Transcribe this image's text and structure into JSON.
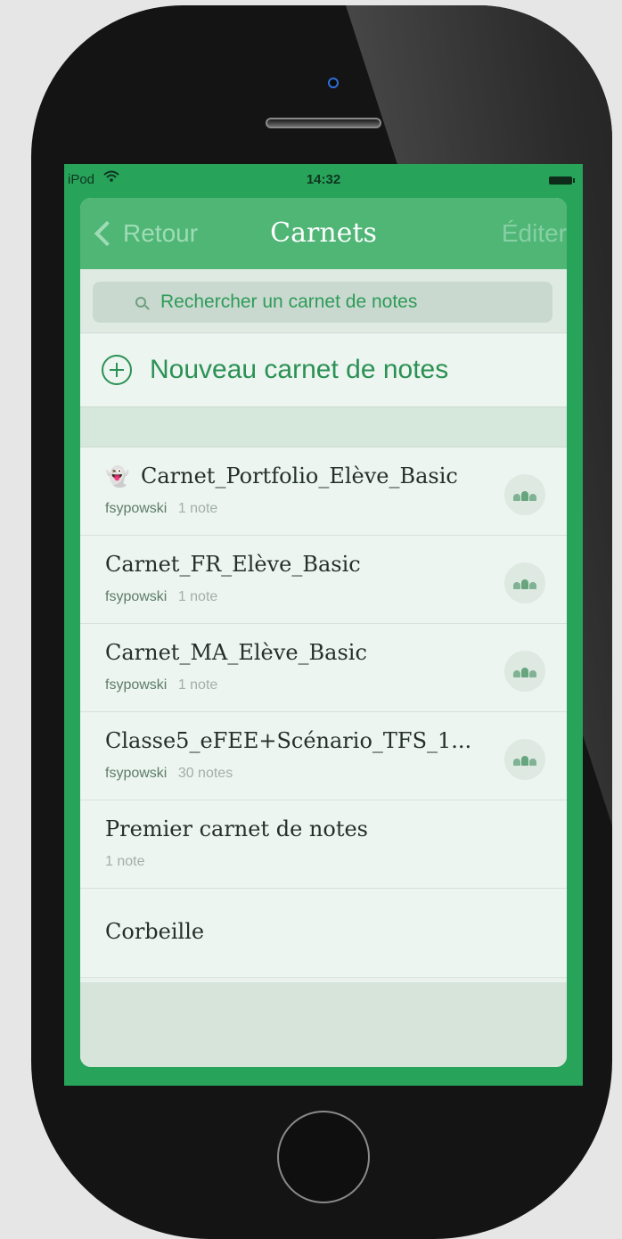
{
  "status_bar": {
    "carrier": "iPod",
    "wifi_icon": "wifi-icon",
    "time": "14:32",
    "battery_icon": "battery-icon"
  },
  "navbar": {
    "back_label": "Retour",
    "title": "Carnets",
    "edit_label": "Éditer"
  },
  "search": {
    "placeholder": "Rechercher un carnet de notes",
    "value": ""
  },
  "new_notebook": {
    "label": "Nouveau carnet de notes",
    "icon": "plus-circle-icon"
  },
  "notebooks": [
    {
      "name": "Carnet_Portfolio_Elève_Basic",
      "owner": "fsypowski",
      "count": "1 note",
      "shared": true,
      "owner_icon": "ghost-avatar-icon"
    },
    {
      "name": "Carnet_FR_Elève_Basic",
      "owner": "fsypowski",
      "count": "1 note",
      "shared": true
    },
    {
      "name": "Carnet_MA_Elève_Basic",
      "owner": "fsypowski",
      "count": "1 note",
      "shared": true
    },
    {
      "name": "Classe5_eFEE+Scénario_TFS_1...",
      "owner": "fsypowski",
      "count": "30 notes",
      "shared": true
    },
    {
      "name": "Premier carnet de notes",
      "owner": "",
      "count": "1 note",
      "shared": false
    }
  ],
  "trash": {
    "label": "Corbeille"
  },
  "colors": {
    "screen_green": "#27a35a",
    "navbar_green": "#4fb676",
    "accent_green": "#2b9154",
    "phone_body": "#141414",
    "background": "#e6e6e6"
  }
}
